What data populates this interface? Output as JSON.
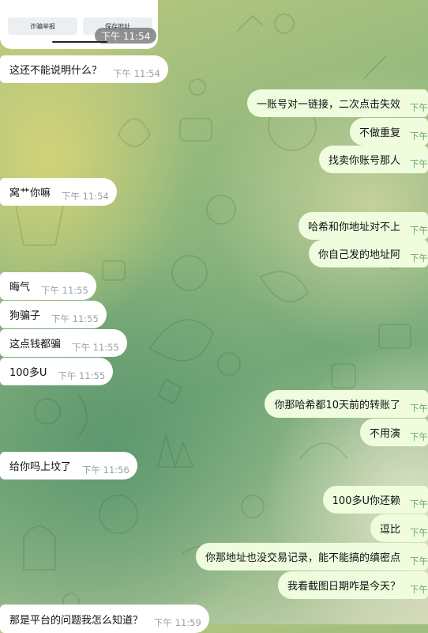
{
  "card": {
    "button_left": "诈骗举报",
    "button_right": "保存地址",
    "time": "下午 11:54"
  },
  "messages": [
    {
      "dir": "in",
      "text": "这还不能说明什么？",
      "time": "下午 11:54"
    },
    {
      "dir": "out",
      "text": "一账号对一链接，二次点击失效",
      "time": "下午"
    },
    {
      "dir": "out",
      "text": "不做重复",
      "time": "下午"
    },
    {
      "dir": "out",
      "text": "找卖你账号那人",
      "time": "下午"
    },
    {
      "dir": "in",
      "text": "窝艹你嘛",
      "time": "下午 11:54"
    },
    {
      "dir": "out",
      "text": "哈希和你地址对不上",
      "time": "下午"
    },
    {
      "dir": "out",
      "text": "你自己发的地址阿",
      "time": "下午"
    },
    {
      "dir": "in",
      "text": "晦气",
      "time": "下午 11:55"
    },
    {
      "dir": "in",
      "text": "狗骗子",
      "time": "下午 11:55"
    },
    {
      "dir": "in",
      "text": "这点钱都骗",
      "time": "下午 11:55"
    },
    {
      "dir": "in",
      "text": "100多U",
      "time": "下午 11:55"
    },
    {
      "dir": "out",
      "text": "你那哈希都10天前的转账了",
      "time": "下午"
    },
    {
      "dir": "out",
      "text": "不用演",
      "time": "下午"
    },
    {
      "dir": "in",
      "text": "给你吗上坟了",
      "time": "下午 11:56"
    },
    {
      "dir": "out",
      "text": "100多U你还赖",
      "time": "下午"
    },
    {
      "dir": "out",
      "text": "逗比",
      "time": "下午"
    },
    {
      "dir": "out",
      "text": "你那地址也没交易记录，能不能搞的缜密点",
      "time": "下午"
    },
    {
      "dir": "out",
      "text": "我看截图日期咋是今天？",
      "time": "下午"
    },
    {
      "dir": "in",
      "text": "那是平台的问题我怎么知道？",
      "time": "下午 11:59"
    }
  ],
  "colors": {
    "incoming_bubble": "#ffffff",
    "outgoing_bubble": "#effdde",
    "outgoing_time": "#6aa56b",
    "incoming_time": "#9aa0a6"
  }
}
